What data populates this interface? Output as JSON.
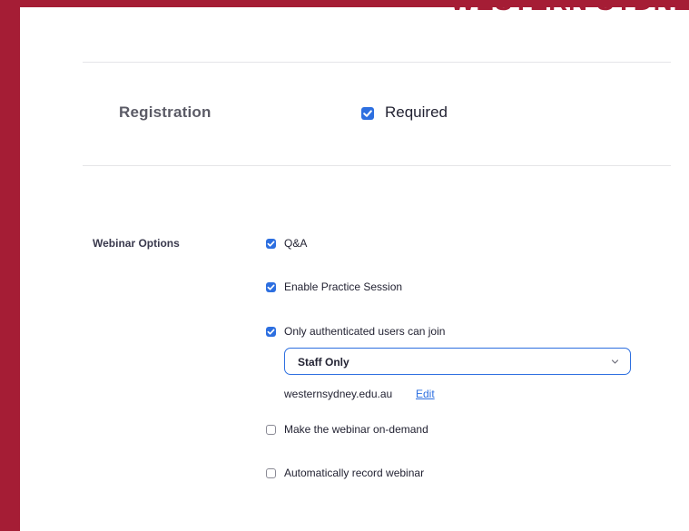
{
  "brand": {
    "text": "WESTERN SYDNEY"
  },
  "registration": {
    "label": "Registration",
    "checkbox_label": "Required",
    "checked": true
  },
  "webinar_options": {
    "label": "Webinar Options",
    "options": [
      {
        "label": "Q&A",
        "checked": true
      },
      {
        "label": "Enable Practice Session",
        "checked": true
      },
      {
        "label": "Only authenticated users can join",
        "checked": true
      },
      {
        "label": "Make the webinar on-demand",
        "checked": false
      },
      {
        "label": "Automatically record webinar",
        "checked": false
      }
    ],
    "auth_select": {
      "value": "Staff Only",
      "icon": "chevron-down-icon"
    },
    "domain": "westernsydney.edu.au",
    "edit_label": "Edit"
  },
  "colors": {
    "accent": "#2d6fe0",
    "brand": "#a51d35"
  }
}
